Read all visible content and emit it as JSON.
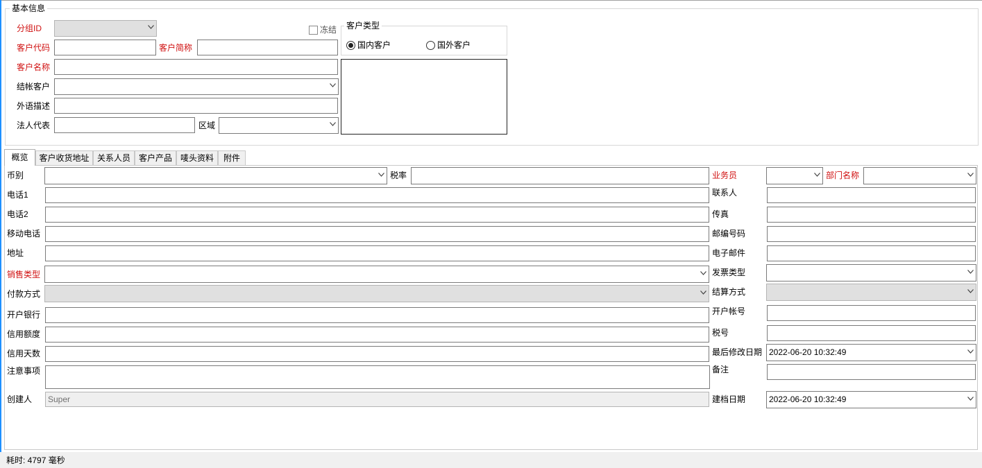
{
  "basic_info": {
    "title": "基本信息",
    "group_id_label": "分组ID",
    "freeze_label": "冻结",
    "customer_code_label": "客户代码",
    "customer_abbr_label": "客户简称",
    "customer_name_label": "客户名称",
    "settle_customer_label": "结帐客户",
    "foreign_desc_label": "外语描述",
    "legal_rep_label": "法人代表",
    "region_label": "区域",
    "customer_type": {
      "title": "客户类型",
      "domestic_label": "国内客户",
      "foreign_label": "国外客户",
      "selected": "国内客户"
    }
  },
  "tabs": [
    {
      "label": "概览",
      "active": true
    },
    {
      "label": "客户收货地址",
      "active": false
    },
    {
      "label": "关系人员",
      "active": false
    },
    {
      "label": "客户产品",
      "active": false
    },
    {
      "label": "唛头资料",
      "active": false
    },
    {
      "label": "附件",
      "active": false
    }
  ],
  "overview": {
    "currency_label": "币别",
    "tax_rate_label": "税率",
    "salesperson_label": "业务员",
    "dept_name_label": "部门名称",
    "phone1_label": "电话1",
    "contact_label": "联系人",
    "phone2_label": "电话2",
    "fax_label": "传真",
    "mobile_label": "移动电话",
    "postal_code_label": "邮编号码",
    "address_label": "地址",
    "email_label": "电子邮件",
    "sales_type_label": "销售类型",
    "invoice_type_label": "发票类型",
    "payment_method_label": "付款方式",
    "settlement_method_label": "结算方式",
    "bank_label": "开户银行",
    "account_no_label": "开户帐号",
    "credit_limit_label": "信用额度",
    "tax_no_label": "税号",
    "credit_days_label": "信用天数",
    "last_modified_label": "最后修改日期",
    "last_modified_value": "2022-06-20 10:32:49",
    "notes_label": "注意事项",
    "remark_label": "备注",
    "creator_label": "创建人",
    "creator_value": "Super",
    "created_date_label": "建档日期",
    "created_date_value": "2022-06-20 10:32:49"
  },
  "status": {
    "elapsed_text": "耗时: 4797 毫秒"
  },
  "colors": {
    "required_label": "#d01010",
    "accent_edge": "#1e90ff",
    "disabled_bg": "#e0e0e0"
  }
}
